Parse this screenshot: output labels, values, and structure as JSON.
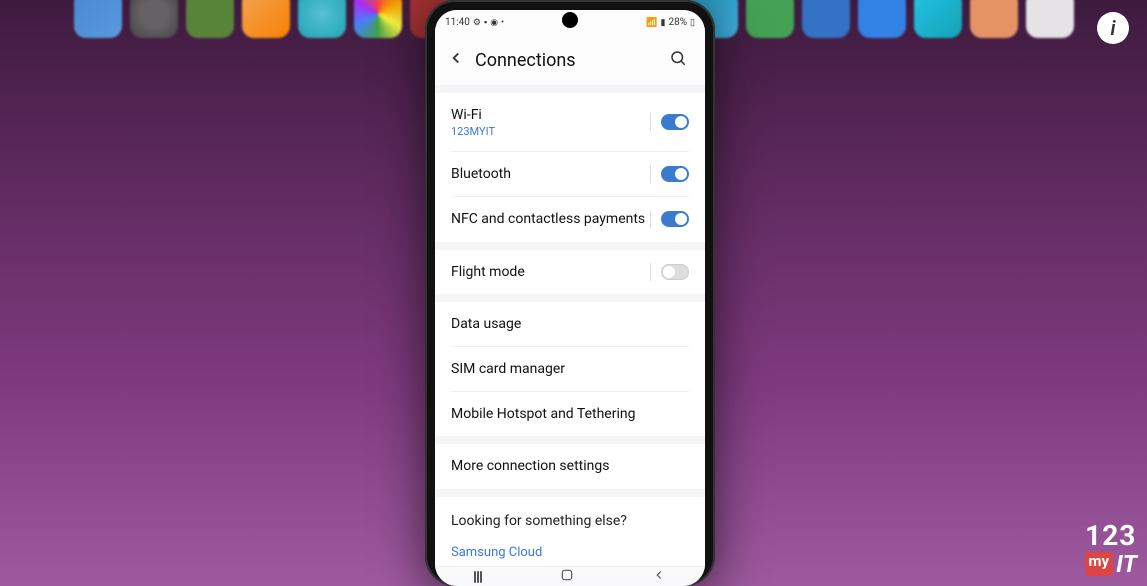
{
  "status_bar": {
    "time": "11:40",
    "battery_text": "28%"
  },
  "header": {
    "title": "Connections"
  },
  "sections": {
    "wifi": {
      "title": "Wi-Fi",
      "subtitle": "123MYIT"
    },
    "bluetooth": {
      "title": "Bluetooth"
    },
    "nfc": {
      "title": "NFC and contactless payments"
    },
    "flight": {
      "title": "Flight mode"
    },
    "data": {
      "title": "Data usage"
    },
    "sim": {
      "title": "SIM card manager"
    },
    "hotspot": {
      "title": "Mobile Hotspot and Tethering"
    },
    "more": {
      "title": "More connection settings"
    }
  },
  "looking": {
    "title": "Looking for something else?",
    "link1": "Samsung Cloud"
  },
  "watermark": {
    "top": "123",
    "my": "my",
    "it": "IT"
  },
  "info_btn": "i"
}
